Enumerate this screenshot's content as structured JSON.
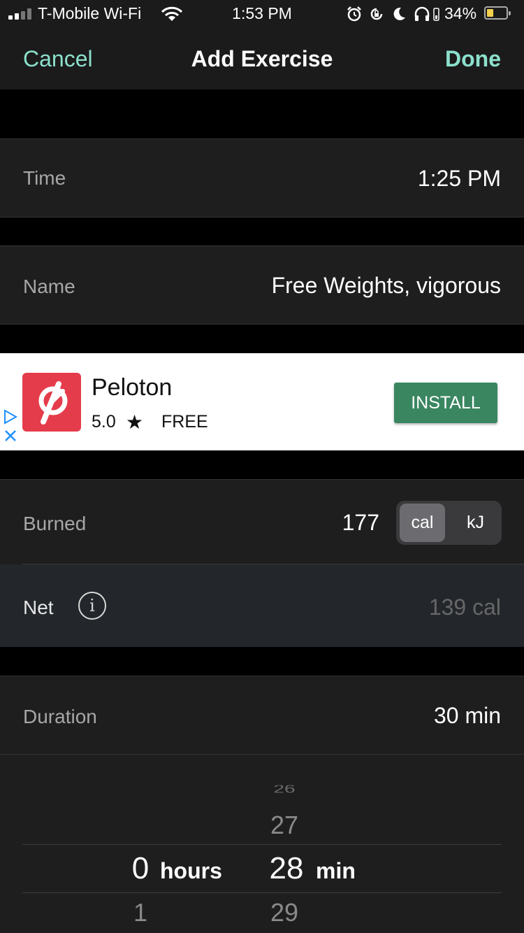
{
  "status_bar": {
    "carrier": "T-Mobile Wi-Fi",
    "time": "1:53 PM",
    "battery_percent": "34%",
    "battery_level": 0.34,
    "icons": [
      "signal-icon",
      "wifi-icon",
      "alarm-icon",
      "rotation-lock-icon",
      "moon-icon",
      "headphones-icon",
      "battery-icon"
    ]
  },
  "nav": {
    "cancel_label": "Cancel",
    "title": "Add Exercise",
    "done_label": "Done"
  },
  "form": {
    "time": {
      "label": "Time",
      "value": "1:25 PM"
    },
    "name": {
      "label": "Name",
      "value": "Free Weights, vigorous"
    },
    "burned": {
      "label": "Burned",
      "value": "177",
      "units": [
        "cal",
        "kJ"
      ],
      "selected_unit": "cal"
    },
    "net": {
      "label": "Net",
      "value": "139 cal"
    },
    "duration": {
      "label": "Duration",
      "value": "30 min"
    }
  },
  "ad": {
    "app_name": "Peloton",
    "rating": "5.0",
    "price": "FREE",
    "install_label": "INSTALL",
    "logo_color": "#e53c4b",
    "install_color": "#3a8660"
  },
  "picker": {
    "hours": {
      "above": "",
      "selected": "0",
      "below": "1",
      "unit": "hours"
    },
    "minutes": {
      "far_above": "26",
      "above": "27",
      "selected": "28",
      "below": "29",
      "unit": "min"
    }
  },
  "colors": {
    "accent": "#8ce0cc",
    "background": "#000000",
    "row_background": "#1e1e1e"
  }
}
